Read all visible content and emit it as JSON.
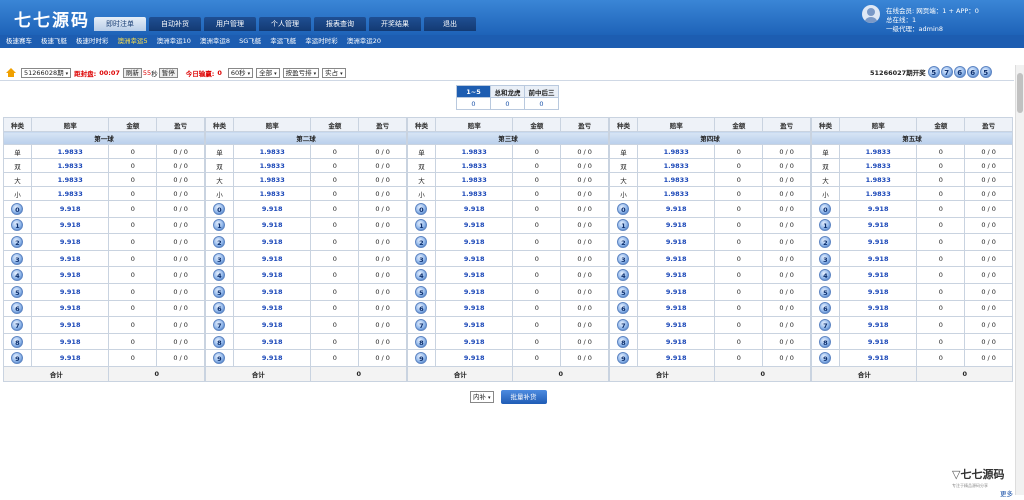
{
  "app": {
    "logo": "七七源码"
  },
  "nav": [
    "即时注单",
    "自动补货",
    "用户管理",
    "个人管理",
    "报表查询",
    "开奖结果",
    "退出"
  ],
  "nav_active": 0,
  "user": {
    "online_members": "在线会员:",
    "pages_label": "网页端：1 + APP：0",
    "total_online": "总在线：",
    "total_online_val": "1",
    "agent_label": "一级代理：",
    "agent_val": "admin8"
  },
  "subnav": [
    "极速赛车",
    "极速飞艇",
    "极速时时彩",
    "澳洲幸运5",
    "澳洲幸运10",
    "澳洲幸运8",
    "SG飞艇",
    "幸运飞艇",
    "幸运时时彩",
    "澳洲幸运20"
  ],
  "subnav_active": 3,
  "controls": {
    "period_select": "51266028期",
    "close_label": "距封盘:",
    "close_time": "00:07",
    "refresh_btn": "刷新",
    "seconds": "55",
    "seconds_unit": "秒",
    "pause_btn": "暂停",
    "today_label": "今日输赢:",
    "today_val": "0",
    "interval_select": "60秒",
    "scope_select": "全部",
    "sort_select": "按盈亏排",
    "mode_select": "实占"
  },
  "last_result": {
    "label": "51266027期开奖",
    "balls": [
      "5",
      "7",
      "6",
      "6",
      "5"
    ]
  },
  "top_tabs": {
    "headers": [
      "1~5",
      "总和龙虎",
      "前中后三"
    ],
    "values": [
      "0",
      "0",
      "0"
    ]
  },
  "table_headers": [
    "种类",
    "赔率",
    "金额",
    "盈亏"
  ],
  "groups": [
    {
      "title": "第一球"
    },
    {
      "title": "第二球"
    },
    {
      "title": "第三球"
    },
    {
      "title": "第四球"
    },
    {
      "title": "第五球"
    }
  ],
  "text_rows": [
    {
      "type": "单",
      "odds": "1.9833",
      "amount": "0",
      "pl": "0 / 0"
    },
    {
      "type": "双",
      "odds": "1.9833",
      "amount": "0",
      "pl": "0 / 0"
    },
    {
      "type": "大",
      "odds": "1.9833",
      "amount": "0",
      "pl": "0 / 0"
    },
    {
      "type": "小",
      "odds": "1.9833",
      "amount": "0",
      "pl": "0 / 0"
    }
  ],
  "num_rows": [
    {
      "num": "0",
      "odds": "9.918",
      "amount": "0",
      "pl": "0 / 0"
    },
    {
      "num": "1",
      "odds": "9.918",
      "amount": "0",
      "pl": "0 / 0"
    },
    {
      "num": "2",
      "odds": "9.918",
      "amount": "0",
      "pl": "0 / 0"
    },
    {
      "num": "3",
      "odds": "9.918",
      "amount": "0",
      "pl": "0 / 0"
    },
    {
      "num": "4",
      "odds": "9.918",
      "amount": "0",
      "pl": "0 / 0"
    },
    {
      "num": "5",
      "odds": "9.918",
      "amount": "0",
      "pl": "0 / 0"
    },
    {
      "num": "6",
      "odds": "9.918",
      "amount": "0",
      "pl": "0 / 0"
    },
    {
      "num": "7",
      "odds": "9.918",
      "amount": "0",
      "pl": "0 / 0"
    },
    {
      "num": "8",
      "odds": "9.918",
      "amount": "0",
      "pl": "0 / 0"
    },
    {
      "num": "9",
      "odds": "9.918",
      "amount": "0",
      "pl": "0 / 0"
    }
  ],
  "sum_row": {
    "label": "合计",
    "value": "0"
  },
  "bottom": {
    "select": "内补",
    "button": "批量补货"
  },
  "watermark": {
    "logo": "七七源码",
    "sub": "专注于精品源码分享"
  },
  "more": "更多"
}
